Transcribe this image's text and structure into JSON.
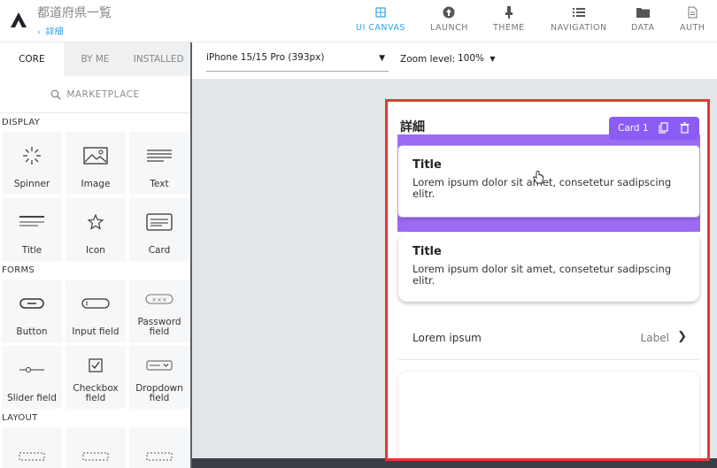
{
  "header": {
    "app_title": "都道府県一覧",
    "breadcrumb": "詳細",
    "nav": [
      {
        "label": "UI CANVAS",
        "icon": "grid-icon",
        "active": true
      },
      {
        "label": "LAUNCH",
        "icon": "rocket-icon",
        "active": false
      },
      {
        "label": "THEME",
        "icon": "brush-icon",
        "active": false
      },
      {
        "label": "NAVIGATION",
        "icon": "list-icon",
        "active": false
      },
      {
        "label": "DATA",
        "icon": "folder-icon",
        "active": false
      },
      {
        "label": "AUTH",
        "icon": "document-icon",
        "active": false
      }
    ]
  },
  "left": {
    "tabs": [
      "CORE",
      "BY ME",
      "INSTALLED"
    ],
    "marketplace": "MARKETPLACE",
    "sections": {
      "display": {
        "title": "DISPLAY",
        "items": [
          "Spinner",
          "Image",
          "Text",
          "Title",
          "Icon",
          "Card"
        ]
      },
      "forms": {
        "title": "FORMS",
        "items": [
          "Button",
          "Input field",
          "Password field",
          "Slider field",
          "Checkbox field",
          "Dropdown field"
        ]
      },
      "layout": {
        "title": "LAYOUT"
      }
    }
  },
  "toolbar": {
    "device": "iPhone 15/15 Pro (393px)",
    "zoom_label": "Zoom level:",
    "zoom_value": "100%"
  },
  "screen": {
    "title": "詳細",
    "selected_badge": "Card 1",
    "cards": [
      {
        "title": "Title",
        "body": "Lorem ipsum dolor sit amet, consetetur sadipscing elitr."
      },
      {
        "title": "Title",
        "body": "Lorem ipsum dolor sit amet, consetetur sadipscing elitr."
      }
    ],
    "list_row": {
      "left": "Lorem ipsum",
      "right": "Label"
    }
  },
  "colors": {
    "accent": "#2fa4e7",
    "selection": "#8b5cf6",
    "frame": "#e5392f"
  }
}
